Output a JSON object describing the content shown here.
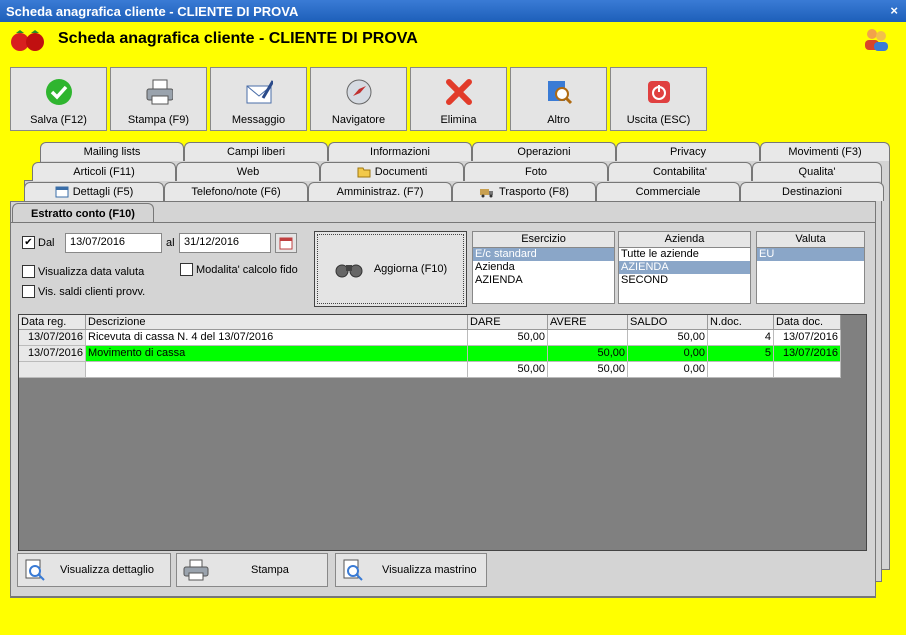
{
  "window": {
    "title": "Scheda anagrafica cliente - CLIENTE DI PROVA",
    "close": "×"
  },
  "header": {
    "title": "Scheda anagrafica cliente - CLIENTE DI PROVA"
  },
  "toolbar": {
    "save": "Salva (F12)",
    "print": "Stampa (F9)",
    "message": "Messaggio",
    "navigator": "Navigatore",
    "delete": "Elimina",
    "other": "Altro",
    "exit": "Uscita (ESC)"
  },
  "tabs": {
    "row1": [
      "Mailing lists",
      "Campi liberi",
      "Informazioni",
      "Operazioni",
      "Privacy",
      "Movimenti (F3)"
    ],
    "row2": [
      "Articoli (F11)",
      "Web",
      "Documenti",
      "Foto",
      "Contabilita'",
      "Qualita'"
    ],
    "row3": [
      "Dettagli (F5)",
      "Telefono/note (F6)",
      "Amministraz. (F7)",
      "Trasporto (F8)",
      "Commerciale",
      "Destinazioni"
    ],
    "subtab": "Estratto conto (F10)"
  },
  "filters": {
    "from_label": "Dal",
    "from_date": "13/07/2016",
    "to_label": "al",
    "to_date": "31/12/2016",
    "show_value_date": "Visualizza data valuta",
    "show_provisional": "Vis. saldi clienti provv.",
    "fido_mode": "Modalita' calcolo fido",
    "refresh": "Aggiorna (F10)"
  },
  "lists": {
    "esercizio": {
      "title": "Esercizio",
      "items": [
        "E/c standard",
        "Azienda",
        "AZIENDA"
      ],
      "selected": 0
    },
    "azienda": {
      "title": "Azienda",
      "items": [
        "Tutte le aziende",
        "AZIENDA",
        "SECOND"
      ],
      "selected": 1
    },
    "valuta": {
      "title": "Valuta",
      "items": [
        "EU"
      ],
      "selected": 0
    }
  },
  "table": {
    "columns": [
      "Data reg.",
      "Descrizione",
      "DARE",
      "AVERE",
      "SALDO",
      "N.doc.",
      "Data doc."
    ],
    "rows": [
      [
        "13/07/2016",
        "Ricevuta di cassa N. 4 del 13/07/2016",
        "50,00",
        "",
        "50,00",
        "4",
        "13/07/2016"
      ],
      [
        "13/07/2016",
        "Movimento di cassa",
        "",
        "50,00",
        "0,00",
        "5",
        "13/07/2016"
      ],
      [
        "",
        "",
        "50,00",
        "50,00",
        "0,00",
        "",
        ""
      ]
    ],
    "highlight_row": 1,
    "highlight_color": "#00ff00"
  },
  "bottom": {
    "detail": "Visualizza dettaglio",
    "print": "Stampa",
    "ledger": "Visualizza mastrino"
  }
}
